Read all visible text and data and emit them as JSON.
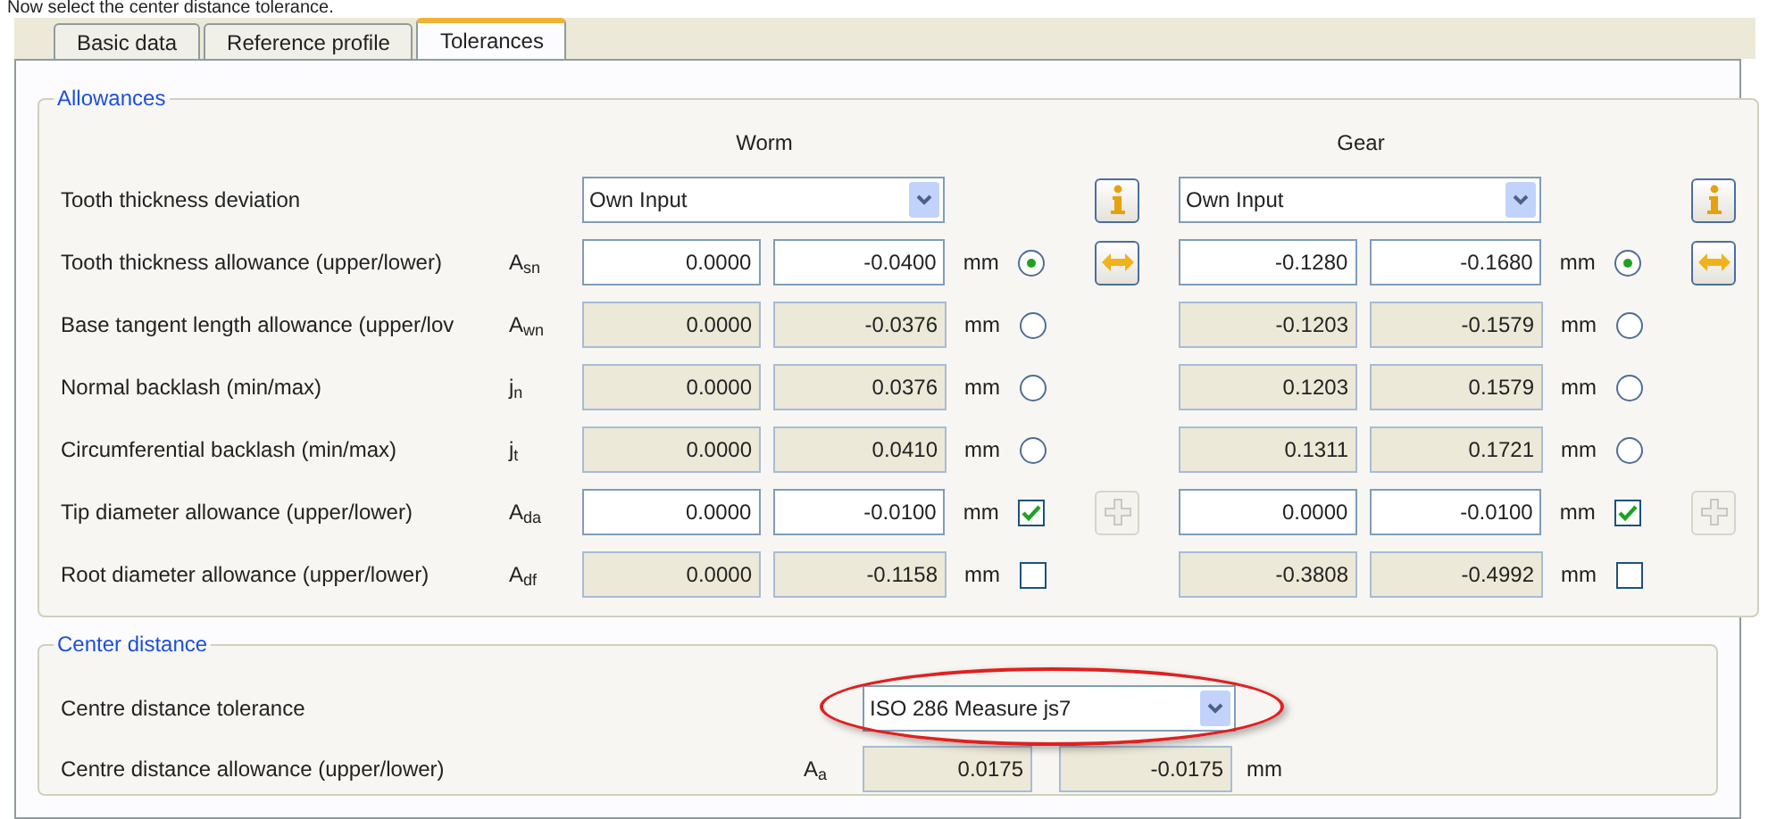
{
  "caption": "Now select the center distance tolerance.",
  "tabs": [
    {
      "label": "Basic data",
      "selected": false
    },
    {
      "label": "Reference profile",
      "selected": false
    },
    {
      "label": "Tolerances",
      "selected": true
    }
  ],
  "allowances": {
    "title": "Allowances",
    "columns": [
      "Worm",
      "Gear"
    ],
    "rows": [
      {
        "kind": "dropdown",
        "label": "Tooth thickness deviation",
        "sides": [
          {
            "value": "Own Input",
            "button": {
              "kind": "info",
              "disabled": false
            }
          },
          {
            "value": "Own Input",
            "button": {
              "kind": "info",
              "disabled": false
            }
          }
        ]
      },
      {
        "kind": "values",
        "label": "Tooth thickness allowance (upper/lower)",
        "symbol": "A$_{sn}$",
        "sides": [
          {
            "upper": "0.0000",
            "lower": "-0.0400",
            "editable": true,
            "unit": "mm",
            "choice": {
              "kind": "radio",
              "checked": true
            },
            "button": {
              "kind": "swap",
              "disabled": false
            }
          },
          {
            "upper": "-0.1280",
            "lower": "-0.1680",
            "editable": true,
            "unit": "mm",
            "choice": {
              "kind": "radio",
              "checked": true
            },
            "button": {
              "kind": "swap",
              "disabled": false
            }
          }
        ]
      },
      {
        "kind": "values",
        "label": "Base tangent length allowance (upper/lov",
        "symbol": "A$_{wn}$",
        "sides": [
          {
            "upper": "0.0000",
            "lower": "-0.0376",
            "editable": false,
            "unit": "mm",
            "choice": {
              "kind": "radio",
              "checked": false
            }
          },
          {
            "upper": "-0.1203",
            "lower": "-0.1579",
            "editable": false,
            "unit": "mm",
            "choice": {
              "kind": "radio",
              "checked": false
            }
          }
        ]
      },
      {
        "kind": "values",
        "label": "Normal backlash (min/max)",
        "symbol": "j$_{n}$",
        "sides": [
          {
            "upper": "0.0000",
            "lower": "0.0376",
            "editable": false,
            "unit": "mm",
            "choice": {
              "kind": "radio",
              "checked": false
            }
          },
          {
            "upper": "0.1203",
            "lower": "0.1579",
            "editable": false,
            "unit": "mm",
            "choice": {
              "kind": "radio",
              "checked": false
            }
          }
        ]
      },
      {
        "kind": "values",
        "label": "Circumferential backlash (min/max)",
        "symbol": "j$_{t}$",
        "sides": [
          {
            "upper": "0.0000",
            "lower": "0.0410",
            "editable": false,
            "unit": "mm",
            "choice": {
              "kind": "radio",
              "checked": false
            }
          },
          {
            "upper": "0.1311",
            "lower": "0.1721",
            "editable": false,
            "unit": "mm",
            "choice": {
              "kind": "radio",
              "checked": false
            }
          }
        ]
      },
      {
        "kind": "values",
        "label": "Tip diameter allowance (upper/lower)",
        "symbol": "A$_{da}$",
        "sides": [
          {
            "upper": "0.0000",
            "lower": "-0.0100",
            "editable": true,
            "unit": "mm",
            "choice": {
              "kind": "checkbox",
              "checked": true
            },
            "button": {
              "kind": "add",
              "disabled": true
            }
          },
          {
            "upper": "0.0000",
            "lower": "-0.0100",
            "editable": true,
            "unit": "mm",
            "choice": {
              "kind": "checkbox",
              "checked": true
            },
            "button": {
              "kind": "add",
              "disabled": true
            }
          }
        ]
      },
      {
        "kind": "values",
        "label": "Root diameter allowance (upper/lower)",
        "symbol": "A$_{df}$",
        "sides": [
          {
            "upper": "0.0000",
            "lower": "-0.1158",
            "editable": false,
            "unit": "mm",
            "choice": {
              "kind": "checkbox",
              "checked": false
            }
          },
          {
            "upper": "-0.3808",
            "lower": "-0.4992",
            "editable": false,
            "unit": "mm",
            "choice": {
              "kind": "checkbox",
              "checked": false
            }
          }
        ]
      }
    ]
  },
  "center_distance": {
    "title": "Center distance",
    "tolerance": {
      "label": "Centre distance tolerance",
      "value": "ISO 286 Measure js7",
      "highlighted": true
    },
    "allowance": {
      "label": "Centre distance allowance (upper/lower)",
      "symbol": "A$_{a}$",
      "upper": "0.0175",
      "lower": "-0.0175",
      "editable": false,
      "unit": "mm"
    }
  }
}
